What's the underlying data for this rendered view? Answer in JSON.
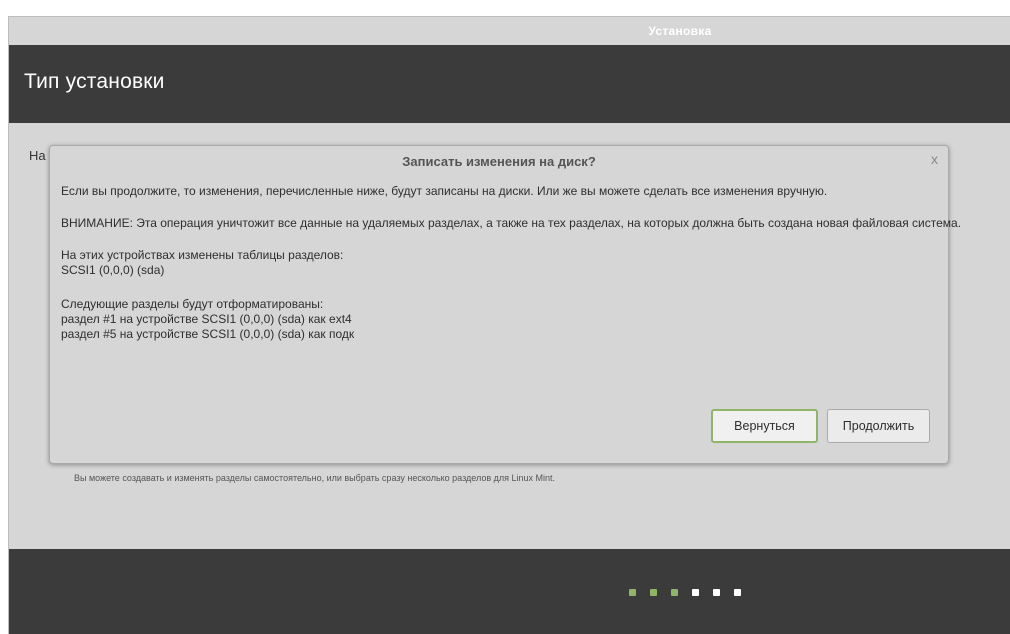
{
  "window": {
    "title": "Установка"
  },
  "header": {
    "title": "Тип установки"
  },
  "background": {
    "label_fragment": "На",
    "hint_text": "Вы можете создавать и изменять разделы самостоятельно, или выбрать сразу несколько разделов для Linux Mint."
  },
  "dialog": {
    "title": "Записать изменения на диск?",
    "close_glyph": "x",
    "intro": "Если вы продолжите, то изменения, перечисленные ниже, будут записаны на диски. Или же вы можете сделать все изменения вручную.",
    "warning": "ВНИМАНИЕ: Эта операция уничтожит все данные на удаляемых разделах, а также на тех разделах, на которых должна быть создана новая файловая система.",
    "partition_tables_heading": "На этих устройствах изменены таблицы разделов:",
    "partition_tables_devices": [
      " SCSI1 (0,0,0) (sda)"
    ],
    "format_heading": "Следующие разделы будут отформатированы:",
    "format_items": [
      " раздел #1 на устройстве SCSI1 (0,0,0) (sda) как ext4",
      " раздел #5 на устройстве SCSI1 (0,0,0) (sda) как подк"
    ],
    "back_label": "Вернуться",
    "continue_label": "Продолжить"
  },
  "progress": {
    "step_colors": [
      "#8fb46a",
      "#8fb46a",
      "#8fb46a",
      "#ffffff",
      "#ffffff",
      "#ffffff"
    ],
    "completed_steps": 3,
    "total_steps": 6
  }
}
